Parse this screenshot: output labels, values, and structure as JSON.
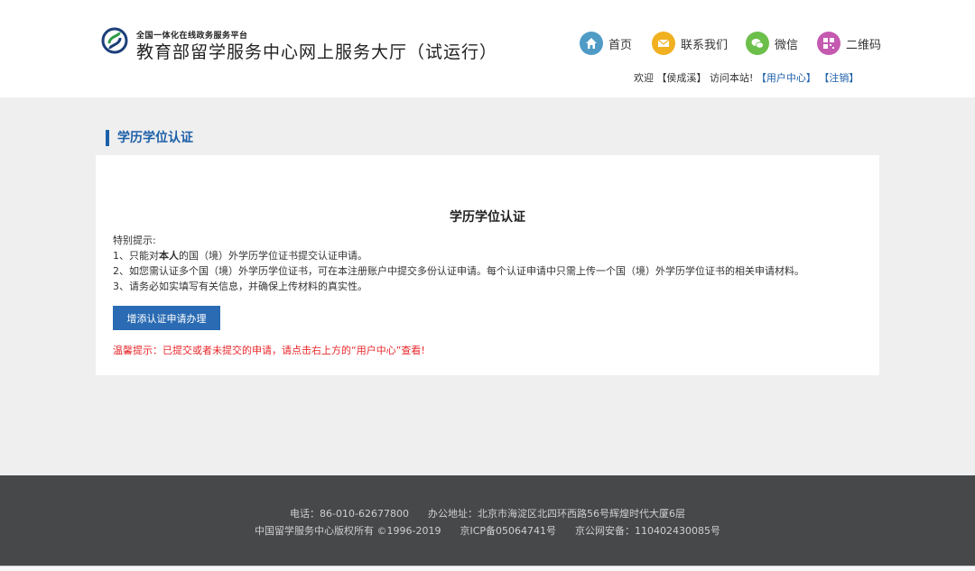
{
  "header": {
    "logo_subtitle": "全国一体化在线政务服务平台",
    "logo_title": "教育部留学服务中心网上服务大厅（试运行）",
    "nav": {
      "home": "首页",
      "contact": "联系我们",
      "wechat": "微信",
      "qrcode": "二维码"
    },
    "icons": {
      "home": "home-icon",
      "contact": "mail-icon",
      "wechat": "wechat-icon",
      "qrcode": "qr-code-icon"
    },
    "welcome_prefix": "欢迎",
    "user_name": "【侯成溪】",
    "welcome_suffix": "访问本站!",
    "user_center_link": "【用户中心】",
    "logout_link": "【注销】"
  },
  "section_title": "学历学位认证",
  "panel": {
    "title": "学历学位认证",
    "notice_heading": "特别提示:",
    "note1_prefix": "1、只能对",
    "note1_bold": "本人",
    "note1_suffix": "的国（境）外学历学位证书提交认证申请。",
    "note2": "2、如您需认证多个国（境）外学历学位证书，可在本注册账户中提交多份认证申请。每个认证申请中只需上传一个国（境）外学历学位证书的相关申请材料。",
    "note3": "3、请务必如实填写有关信息，并确保上传材料的真实性。",
    "add_button": "增添认证申请办理",
    "tip": "温馨提示：已提交或者未提交的申请，请点击右上方的“用户中心”查看!"
  },
  "footer": {
    "line1": "电话：86-010-62677800      办公地址：北京市海淀区北四环西路56号辉煌时代大厦6层",
    "line2": "中国留学服务中心版权所有 ©1996-2019      京ICP备05064741号      京公网安备：110402430085号"
  },
  "colors": {
    "accent": "#1c5fa8",
    "button": "#2a6bb3",
    "warning": "#e8262a",
    "footer_bg": "#47484a"
  }
}
